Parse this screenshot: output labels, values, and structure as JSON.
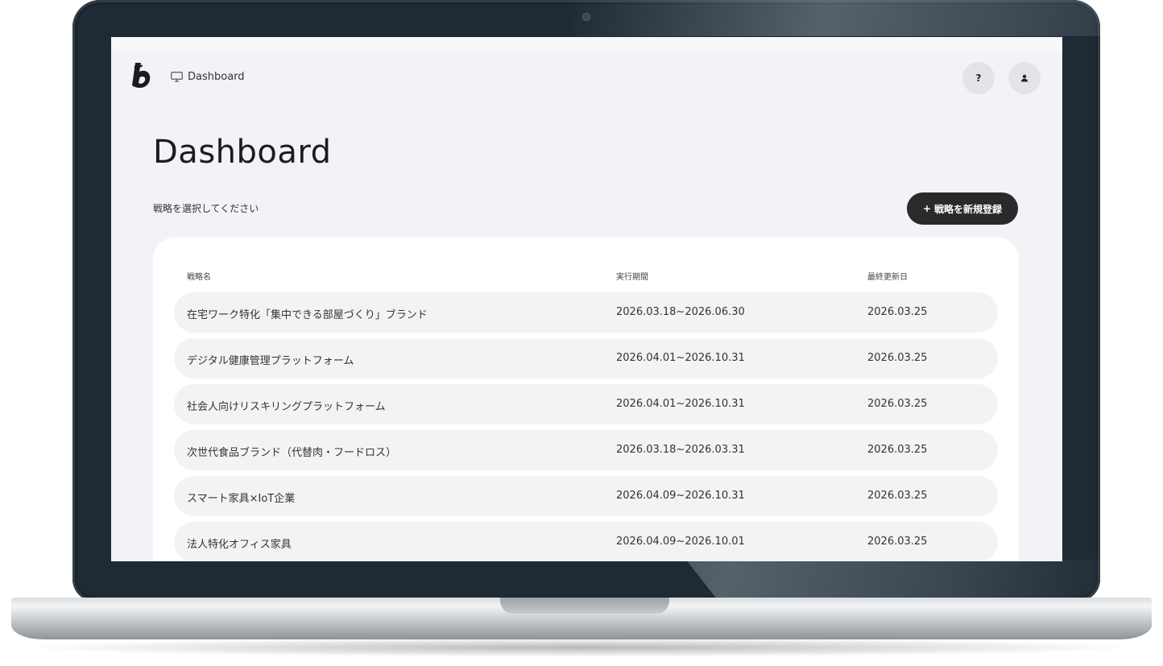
{
  "breadcrumb": {
    "label": "Dashboard"
  },
  "header": {
    "help_label": "?",
    "help_icon": "question-icon",
    "user_icon": "user-icon"
  },
  "page": {
    "title": "Dashboard",
    "subtitle": "戦略を選択してください",
    "new_button_plus": "+",
    "new_button_label": "戦略を新規登録"
  },
  "table": {
    "columns": [
      "戦略名",
      "実行期間",
      "最終更新日"
    ],
    "rows": [
      {
        "name": "在宅ワーク特化「集中できる部屋づくり」ブランド",
        "period": "2026.03.18~2026.06.30",
        "updated": "2026.03.25"
      },
      {
        "name": "デジタル健康管理プラットフォーム",
        "period": "2026.04.01~2026.10.31",
        "updated": "2026.03.25"
      },
      {
        "name": "社会人向けリスキリングプラットフォーム",
        "period": "2026.04.01~2026.10.31",
        "updated": "2026.03.25"
      },
      {
        "name": "次世代食品ブランド（代替肉・フードロス）",
        "period": "2026.03.18~2026.03.31",
        "updated": "2026.03.25"
      },
      {
        "name": "スマート家具×IoT企業",
        "period": "2026.04.09~2026.10.31",
        "updated": "2026.03.25"
      },
      {
        "name": "法人特化オフィス家具",
        "period": "2026.04.09~2026.10.01",
        "updated": "2026.03.25"
      }
    ]
  },
  "colors": {
    "background": "#f3f3f7",
    "card": "#ffffff",
    "row": "#f3f3f6",
    "primary_button": "#2a2a2c",
    "frame": "#1e2a34"
  }
}
